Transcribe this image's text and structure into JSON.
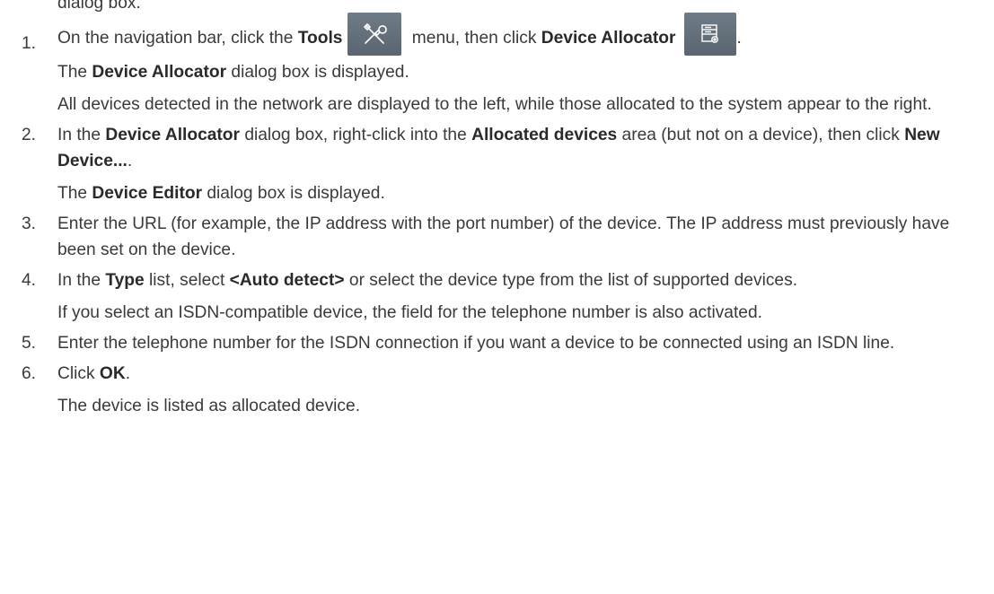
{
  "intro": "dialog box.",
  "icons": {
    "tools": "tools-icon",
    "device_allocator": "device-allocator-icon"
  },
  "colors": {
    "text": "#3a3a3a",
    "icon_bg": "#5f6b76"
  },
  "steps": [
    {
      "number": "1.",
      "action": {
        "t1": "On the navigation bar, click the ",
        "b1": "Tools",
        "t2": " menu, then click ",
        "b2": "Device Allocator",
        "t3": "."
      },
      "result": {
        "t1": "The ",
        "b1": "Device Allocator",
        "t2": " dialog box is displayed."
      },
      "note": "All devices detected in the network are displayed to the left, while those allocated to the system appear to the right."
    },
    {
      "number": "2.",
      "action": {
        "t1": "In the ",
        "b1": "Device Allocator",
        "t2": " dialog box, right-click into the ",
        "b2": "Allocated devices",
        "t3": " area (but not on a device), then click ",
        "b3": "New Device...",
        "t4": "."
      },
      "result": {
        "t1": "The ",
        "b1": "Device Editor",
        "t2": " dialog box is displayed."
      }
    },
    {
      "number": "3.",
      "text": "Enter the URL (for example, the IP address with the port number) of the device. The IP address must previously have been set on the device."
    },
    {
      "number": "4.",
      "action": {
        "t1": "In the ",
        "b1": "Type",
        "t2": " list, select ",
        "b2": "<Auto detect>",
        "t3": " or select the device type from the list of supported devices."
      },
      "note": "If you select an ISDN-compatible device, the field for the telephone number is also activated."
    },
    {
      "number": "5.",
      "text": "Enter the telephone number for the ISDN connection if you want a device to be connected using an ISDN line."
    },
    {
      "number": "6.",
      "action": {
        "t1": "Click ",
        "b1": "OK",
        "t2": "."
      },
      "result_text": "The device is listed as allocated device."
    }
  ]
}
